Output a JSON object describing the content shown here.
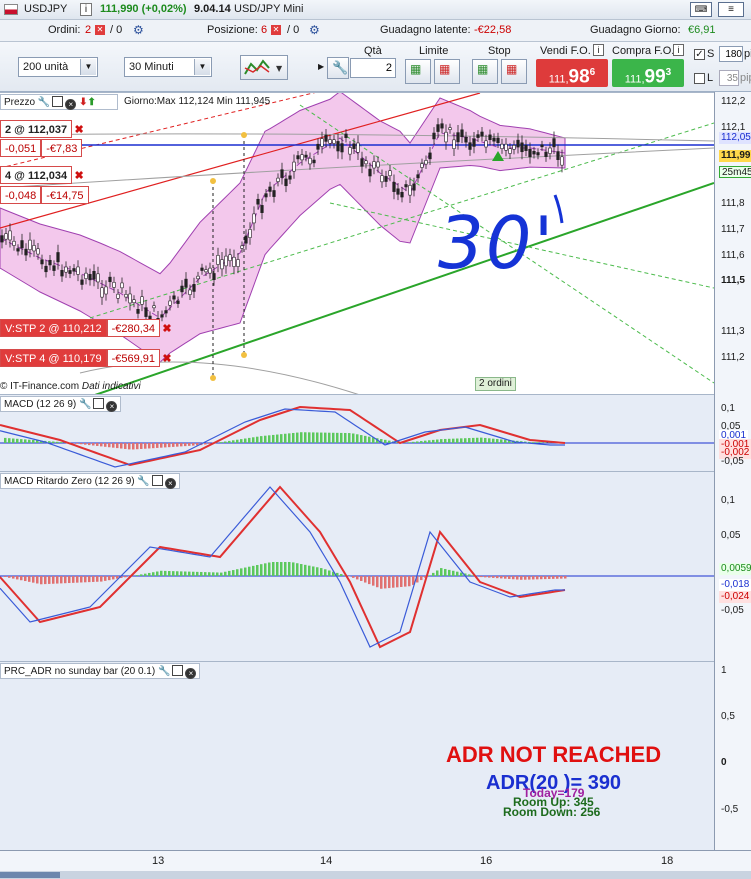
{
  "titlebar": {
    "symbol": "USDJPY",
    "last": "111,990 (+0,02%)",
    "time": "9.04.14",
    "market": "USD/JPY Mini"
  },
  "infobar": {
    "orders_label": "Ordini:",
    "orders_count": "2",
    "orders_zero": "/ 0",
    "positions_label": "Posizione:",
    "positions_count": "6",
    "positions_zero": "/ 0",
    "latent_label": "Guadagno latente:",
    "latent_value": "-€22,58",
    "day_label": "Guadagno Giorno:",
    "day_value": "€6,91"
  },
  "toolbar": {
    "size_value": "200 unità",
    "timeframe_value": "30 Minuti",
    "qty_label": "Qtà",
    "qty_value": "2",
    "limit_label": "Limite",
    "stop_label": "Stop",
    "sell_label": "Vendi F.O.",
    "buy_label": "Compra F.O.",
    "sell_price_main": "111,98",
    "sell_price_small": "111,",
    "sell_price_sup": "6",
    "buy_price_main": "99",
    "buy_price_small": "111,",
    "buy_price_sup": "3",
    "s_label": "S",
    "s_value": "180",
    "s_unit": "pi",
    "l_label": "L",
    "l_value": "35",
    "l_unit": "pip"
  },
  "price_pane": {
    "title": "Prezzo",
    "range_text": "Giorno:Max 112,124 Min 111,945",
    "credit": "© IT-Finance.com",
    "credit_italic": "Dati indicativi",
    "orders_badge": "2 ordini",
    "annotation": "30'",
    "axis": [
      "112,2",
      "112,1",
      "111,8",
      "111,7",
      "111,6",
      "111,5",
      "111,3",
      "111,2"
    ],
    "axis_tags": {
      "blue": "112,05",
      "yellow": "111,99",
      "timer": "25m45"
    },
    "positions": [
      {
        "label": "2 @ 112,037",
        "pnl_pips": "-0,051",
        "pnl": "-€7,83"
      },
      {
        "label": "4 @ 112,034",
        "pnl_pips": "-0,048",
        "pnl": "-€14,75"
      }
    ],
    "stops": [
      {
        "label": "V:STP 2 @ 110,212",
        "pnl": "-€280,34"
      },
      {
        "label": "V:STP 4 @ 110,179",
        "pnl": "-€569,91"
      }
    ]
  },
  "macd_pane": {
    "title": "MACD (12 26 9)",
    "axis": [
      "0,1",
      "0,05",
      "-0,05"
    ],
    "tags": [
      "0,001",
      "-0,001",
      "-0,002"
    ]
  },
  "macd_zero_pane": {
    "title": "MACD Ritardo Zero (12 26 9)",
    "axis": [
      "0,1",
      "0,05",
      "-0,05"
    ],
    "tags": [
      "0,0059",
      "-0,018",
      "-0,024"
    ]
  },
  "adr_pane": {
    "title": "PRC_ADR no sunday bar (20 0.1)",
    "axis": [
      "1",
      "0,5",
      "0",
      "-0,5"
    ],
    "headline": "ADR NOT REACHED",
    "adr": "ADR(20 )= 390",
    "today": "Today=179",
    "room_up": "Room Up: 345",
    "room_down": "Room Down: 256"
  },
  "time_axis": [
    "13",
    "14",
    "16",
    "18"
  ],
  "colors": {
    "up": "#2aa52a",
    "down": "#e03030",
    "band": "#f3c8ec",
    "accent": "#1a2fd0"
  }
}
